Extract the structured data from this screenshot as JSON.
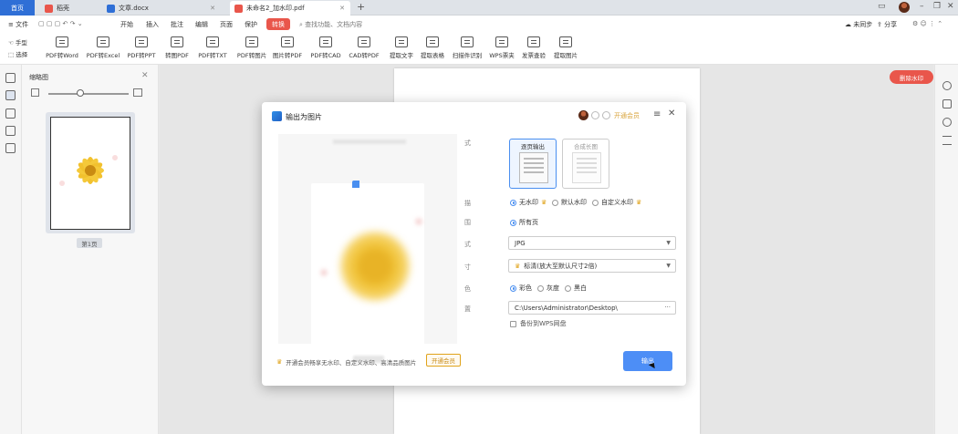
{
  "tabs": {
    "home": "首页",
    "t1": "稻壳",
    "t2": "文章.docx",
    "t3": "未命名2_加水印.pdf"
  },
  "topright": {
    "sync": "未同步",
    "share": "分享"
  },
  "menu": {
    "file": "文件",
    "items": [
      "开始",
      "插入",
      "批注",
      "编辑",
      "页面",
      "保护"
    ],
    "active": "转换",
    "search": "查找功能、文档内容"
  },
  "ribbon": {
    "hand": "手型",
    "select": "选择",
    "items": [
      "PDF转Word",
      "PDF转Excel",
      "PDF转PPT",
      "转图PDF",
      "PDF转TXT",
      "PDF转图片",
      "图片转PDF",
      "PDF转CAD",
      "CAD转PDF",
      "提取文字",
      "提取表格",
      "扫描件识别",
      "WPS票夹",
      "发票查验",
      "提取图片"
    ]
  },
  "thumbnail_panel": {
    "title": "缩略图",
    "page_label": "第1页"
  },
  "remove_watermark": "删除水印",
  "dialog": {
    "title": "输出为图片",
    "vip": "开通会员",
    "mode_row_label": "式",
    "modes": {
      "page_by_page": "逐页输出",
      "merge": "合成长图"
    },
    "watermark": {
      "label": "描",
      "options": [
        "无水印",
        "默认水印",
        "自定义水印"
      ]
    },
    "pages": {
      "label": "围",
      "option": "所有页"
    },
    "format": {
      "label": "式",
      "value": "JPG"
    },
    "size": {
      "label": "寸",
      "value": "标清(放大至默认尺寸2倍)"
    },
    "color": {
      "label": "色",
      "options": [
        "彩色",
        "灰度",
        "黑白"
      ]
    },
    "path": {
      "label": "置",
      "value": "C:\\Users\\Administrator\\Desktop\\",
      "more": "···"
    },
    "backup_label": "备份到WPS网盘",
    "footer_text": "开通会员畅享无水印、自定义水印、高清品质图片",
    "footer_vip": "开通会员",
    "export_label": "输出"
  }
}
